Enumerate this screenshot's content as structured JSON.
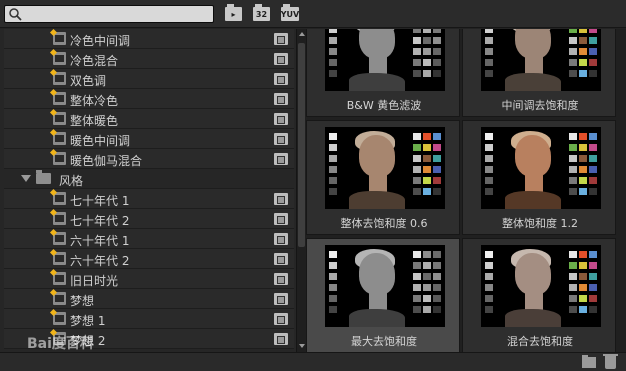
{
  "search": {
    "value": "",
    "placeholder": ""
  },
  "toolbar": {
    "buttons": [
      {
        "name": "accelerated-filter-button",
        "icon": "accelerated-filter-icon",
        "label": ""
      },
      {
        "name": "32bit-filter-button",
        "icon": "32bit-icon",
        "label": "32"
      },
      {
        "name": "yuv-filter-button",
        "icon": "yuv-icon",
        "label": "YUV"
      }
    ]
  },
  "tree": {
    "items": [
      {
        "label": "冷色中间调",
        "type": "preset"
      },
      {
        "label": "冷色混合",
        "type": "preset"
      },
      {
        "label": "双色调",
        "type": "preset"
      },
      {
        "label": "整体冷色",
        "type": "preset"
      },
      {
        "label": "整体暖色",
        "type": "preset"
      },
      {
        "label": "暖色中间调",
        "type": "preset"
      },
      {
        "label": "暖色伽马混合",
        "type": "preset"
      },
      {
        "label": "风格",
        "type": "folder",
        "expanded": true
      },
      {
        "label": "七十年代 1",
        "type": "preset"
      },
      {
        "label": "七十年代 2",
        "type": "preset"
      },
      {
        "label": "六十年代 1",
        "type": "preset"
      },
      {
        "label": "六十年代 2",
        "type": "preset"
      },
      {
        "label": "旧日时光",
        "type": "preset"
      },
      {
        "label": "梦想",
        "type": "preset"
      },
      {
        "label": "梦想 1",
        "type": "preset"
      },
      {
        "label": "梦想 2",
        "type": "preset"
      }
    ]
  },
  "grid": {
    "tiles": [
      {
        "caption": "B&W 黄色滤波",
        "tone": "bw",
        "selected": false
      },
      {
        "caption": "中间调去饱和度",
        "tone": "desat-mid",
        "selected": false
      },
      {
        "caption": "整体去饱和度 0.6",
        "tone": "desat-06",
        "selected": false
      },
      {
        "caption": "整体饱和度 1.2",
        "tone": "sat-12",
        "selected": false
      },
      {
        "caption": "最大去饱和度",
        "tone": "bw",
        "selected": true
      },
      {
        "caption": "混合去饱和度",
        "tone": "desat-mix",
        "selected": false
      }
    ]
  },
  "colors": {
    "accent": "#f0b41c",
    "panel": "#2a2a2a",
    "selected_tile": "#4a4a4a"
  },
  "watermark": {
    "text": "Bai度百科"
  }
}
